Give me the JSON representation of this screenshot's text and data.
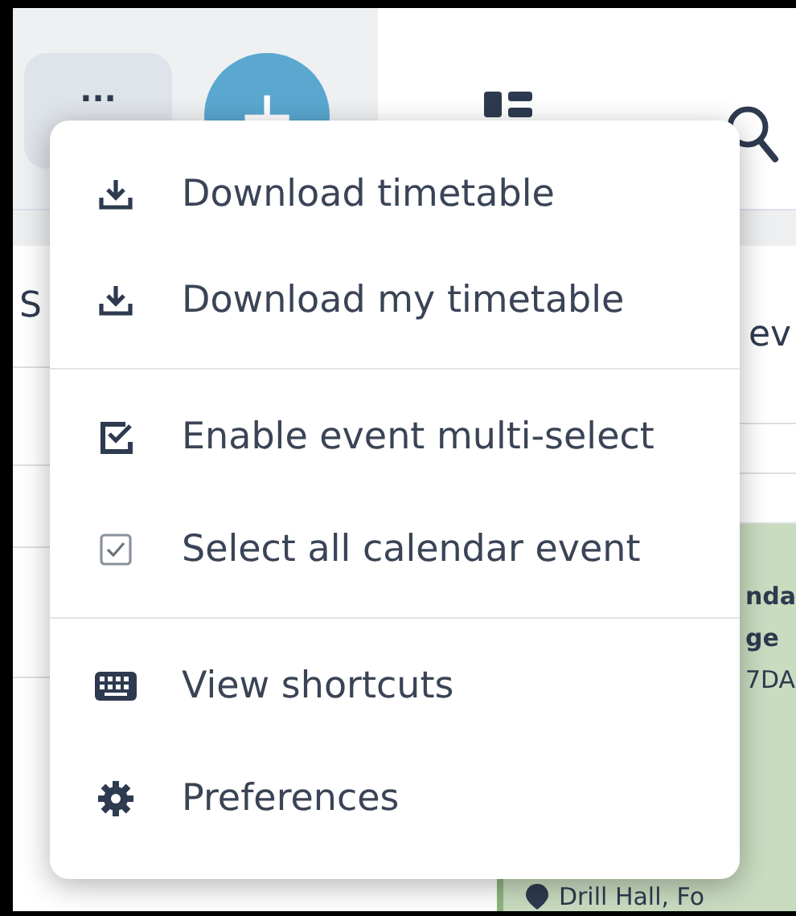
{
  "toolbar": {
    "more_button": "...",
    "add_button": "+"
  },
  "background": {
    "column_text": "S",
    "row_text": "ev",
    "event": {
      "lines": [
        "nda",
        "ge",
        "7DA"
      ],
      "location": "Drill Hall, Fo"
    }
  },
  "menu": {
    "sections": [
      [
        {
          "kind": "download",
          "label": "Download timetable"
        },
        {
          "kind": "download",
          "label": "Download my timetable"
        }
      ],
      [
        {
          "kind": "multiselect",
          "label": "Enable event multi-select"
        },
        {
          "kind": "select-all",
          "label": "Select all calendar event"
        }
      ],
      [
        {
          "kind": "shortcuts",
          "label": "View shortcuts"
        },
        {
          "kind": "preferences",
          "label": "Preferences"
        }
      ]
    ]
  }
}
